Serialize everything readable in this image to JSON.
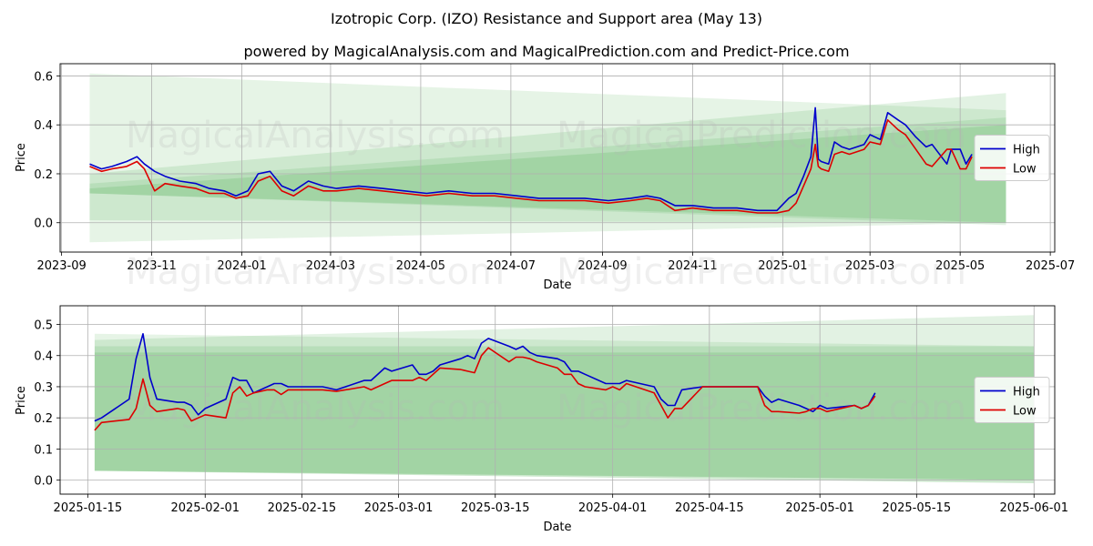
{
  "title": "Izotropic Corp. (IZO) Resistance and Support area (May 13)",
  "subtitle": "powered by MagicalAnalysis.com and MagicalPrediction.com and Predict-Price.com",
  "watermarks": [
    "MagicalAnalysis.com",
    "MagicalPrediction.com"
  ],
  "colors": {
    "high": "#0000cc",
    "low": "#dd0000",
    "band": "#4caf50"
  },
  "chart_data": [
    {
      "type": "line",
      "xlabel": "Date",
      "ylabel": "Price",
      "xlim": [
        "2023-08-31",
        "2025-07-04"
      ],
      "ylim": [
        -0.12,
        0.65
      ],
      "x_ticks": [
        "2023-09",
        "2023-11",
        "2024-01",
        "2024-03",
        "2024-05",
        "2024-07",
        "2024-09",
        "2024-11",
        "2025-01",
        "2025-03",
        "2025-05",
        "2025-07"
      ],
      "y_ticks": [
        0.0,
        0.2,
        0.4,
        0.6
      ],
      "y_tick_labels": [
        "0.0",
        "0.2",
        "0.4",
        "0.6"
      ],
      "grid": true,
      "legend_position": "right",
      "bands": [
        {
          "x": [
            "2023-09-20",
            "2025-06-01"
          ],
          "upper": [
            0.61,
            0.46
          ],
          "lower": [
            -0.08,
            0.0
          ]
        },
        {
          "x": [
            "2023-09-20",
            "2025-06-01"
          ],
          "upper": [
            0.2,
            0.53
          ],
          "lower": [
            0.01,
            0.0
          ]
        },
        {
          "x": [
            "2023-09-20",
            "2025-06-01"
          ],
          "upper": [
            0.16,
            0.43
          ],
          "lower": [
            0.12,
            -0.01
          ]
        },
        {
          "x": [
            "2023-09-20",
            "2025-06-01"
          ],
          "upper": [
            0.14,
            0.4
          ],
          "lower": [
            0.12,
            0.0
          ]
        }
      ],
      "series": [
        {
          "name": "High",
          "x": [
            "2023-09-20",
            "2023-09-28",
            "2023-10-05",
            "2023-10-15",
            "2023-10-22",
            "2023-10-27",
            "2023-11-03",
            "2023-11-10",
            "2023-11-20",
            "2023-12-01",
            "2023-12-10",
            "2023-12-20",
            "2023-12-28",
            "2024-01-05",
            "2024-01-12",
            "2024-01-20",
            "2024-01-28",
            "2024-02-05",
            "2024-02-15",
            "2024-02-25",
            "2024-03-05",
            "2024-03-20",
            "2024-04-05",
            "2024-04-20",
            "2024-05-05",
            "2024-05-20",
            "2024-06-05",
            "2024-06-20",
            "2024-07-05",
            "2024-07-20",
            "2024-08-05",
            "2024-08-20",
            "2024-09-05",
            "2024-09-20",
            "2024-10-01",
            "2024-10-10",
            "2024-10-20",
            "2024-11-01",
            "2024-11-15",
            "2024-12-01",
            "2024-12-15",
            "2024-12-28",
            "2025-01-05",
            "2025-01-10",
            "2025-01-15",
            "2025-01-20",
            "2025-01-23",
            "2025-01-25",
            "2025-01-27",
            "2025-02-01",
            "2025-02-05",
            "2025-02-10",
            "2025-02-15",
            "2025-02-25",
            "2025-03-01",
            "2025-03-08",
            "2025-03-13",
            "2025-03-20",
            "2025-03-25",
            "2025-04-01",
            "2025-04-08",
            "2025-04-12",
            "2025-04-22",
            "2025-04-25",
            "2025-05-01",
            "2025-05-05",
            "2025-05-09"
          ],
          "y": [
            0.24,
            0.22,
            0.23,
            0.25,
            0.27,
            0.24,
            0.21,
            0.19,
            0.17,
            0.16,
            0.14,
            0.13,
            0.11,
            0.13,
            0.2,
            0.21,
            0.15,
            0.13,
            0.17,
            0.15,
            0.14,
            0.15,
            0.14,
            0.13,
            0.12,
            0.13,
            0.12,
            0.12,
            0.11,
            0.1,
            0.1,
            0.1,
            0.09,
            0.1,
            0.11,
            0.1,
            0.07,
            0.07,
            0.06,
            0.06,
            0.05,
            0.05,
            0.1,
            0.12,
            0.19,
            0.27,
            0.47,
            0.26,
            0.25,
            0.24,
            0.33,
            0.31,
            0.3,
            0.32,
            0.36,
            0.34,
            0.45,
            0.42,
            0.4,
            0.35,
            0.31,
            0.32,
            0.24,
            0.3,
            0.3,
            0.24,
            0.28
          ]
        },
        {
          "name": "Low",
          "x": [
            "2023-09-20",
            "2023-09-28",
            "2023-10-05",
            "2023-10-15",
            "2023-10-22",
            "2023-10-27",
            "2023-11-03",
            "2023-11-10",
            "2023-11-20",
            "2023-12-01",
            "2023-12-10",
            "2023-12-20",
            "2023-12-28",
            "2024-01-05",
            "2024-01-12",
            "2024-01-20",
            "2024-01-28",
            "2024-02-05",
            "2024-02-15",
            "2024-02-25",
            "2024-03-05",
            "2024-03-20",
            "2024-04-05",
            "2024-04-20",
            "2024-05-05",
            "2024-05-20",
            "2024-06-05",
            "2024-06-20",
            "2024-07-05",
            "2024-07-20",
            "2024-08-05",
            "2024-08-20",
            "2024-09-05",
            "2024-09-20",
            "2024-10-01",
            "2024-10-10",
            "2024-10-20",
            "2024-11-01",
            "2024-11-15",
            "2024-12-01",
            "2024-12-15",
            "2024-12-28",
            "2025-01-05",
            "2025-01-10",
            "2025-01-15",
            "2025-01-20",
            "2025-01-23",
            "2025-01-25",
            "2025-01-27",
            "2025-02-01",
            "2025-02-05",
            "2025-02-10",
            "2025-02-15",
            "2025-02-25",
            "2025-03-01",
            "2025-03-08",
            "2025-03-13",
            "2025-03-20",
            "2025-03-25",
            "2025-04-01",
            "2025-04-08",
            "2025-04-12",
            "2025-04-22",
            "2025-04-25",
            "2025-05-01",
            "2025-05-05",
            "2025-05-09"
          ],
          "y": [
            0.23,
            0.21,
            0.22,
            0.23,
            0.25,
            0.22,
            0.13,
            0.16,
            0.15,
            0.14,
            0.12,
            0.12,
            0.1,
            0.11,
            0.17,
            0.19,
            0.13,
            0.11,
            0.15,
            0.13,
            0.13,
            0.14,
            0.13,
            0.12,
            0.11,
            0.12,
            0.11,
            0.11,
            0.1,
            0.09,
            0.09,
            0.09,
            0.08,
            0.09,
            0.1,
            0.09,
            0.05,
            0.06,
            0.05,
            0.05,
            0.04,
            0.04,
            0.05,
            0.08,
            0.15,
            0.22,
            0.32,
            0.23,
            0.22,
            0.21,
            0.28,
            0.29,
            0.28,
            0.3,
            0.33,
            0.32,
            0.42,
            0.38,
            0.36,
            0.3,
            0.24,
            0.23,
            0.3,
            0.3,
            0.22,
            0.22,
            0.27
          ]
        }
      ]
    },
    {
      "type": "line",
      "xlabel": "Date",
      "ylabel": "Price",
      "xlim": [
        "2025-01-11",
        "2025-06-04"
      ],
      "ylim": [
        -0.045,
        0.56
      ],
      "x_ticks": [
        "2025-01-15",
        "2025-02-01",
        "2025-02-15",
        "2025-03-01",
        "2025-03-15",
        "2025-04-01",
        "2025-04-15",
        "2025-05-01",
        "2025-05-15",
        "2025-06-01"
      ],
      "y_ticks": [
        0.0,
        0.1,
        0.2,
        0.3,
        0.4,
        0.5
      ],
      "y_tick_labels": [
        "0.0",
        "0.1",
        "0.2",
        "0.3",
        "0.4",
        "0.5"
      ],
      "grid": true,
      "legend_position": "right",
      "bands": [
        {
          "x": [
            "2025-01-16",
            "2025-06-01"
          ],
          "upper": [
            0.47,
            0.43
          ],
          "lower": [
            0.03,
            -0.01
          ]
        },
        {
          "x": [
            "2025-01-16",
            "2025-06-01"
          ],
          "upper": [
            0.45,
            0.53
          ],
          "lower": [
            0.03,
            0.0
          ]
        },
        {
          "x": [
            "2025-01-16",
            "2025-06-01"
          ],
          "upper": [
            0.43,
            0.43
          ],
          "lower": [
            0.03,
            -0.01
          ]
        },
        {
          "x": [
            "2025-01-16",
            "2025-06-01"
          ],
          "upper": [
            0.41,
            0.41
          ],
          "lower": [
            0.03,
            0.0
          ]
        }
      ],
      "series": [
        {
          "name": "High",
          "x": [
            "2025-01-16",
            "2025-01-17",
            "2025-01-21",
            "2025-01-22",
            "2025-01-23",
            "2025-01-24",
            "2025-01-25",
            "2025-01-28",
            "2025-01-29",
            "2025-01-30",
            "2025-01-31",
            "2025-02-01",
            "2025-02-04",
            "2025-02-05",
            "2025-02-06",
            "2025-02-07",
            "2025-02-08",
            "2025-02-10",
            "2025-02-11",
            "2025-02-12",
            "2025-02-13",
            "2025-02-14",
            "2025-02-15",
            "2025-02-18",
            "2025-02-20",
            "2025-02-24",
            "2025-02-25",
            "2025-02-27",
            "2025-02-28",
            "2025-03-03",
            "2025-03-04",
            "2025-03-05",
            "2025-03-06",
            "2025-03-07",
            "2025-03-10",
            "2025-03-11",
            "2025-03-12",
            "2025-03-13",
            "2025-03-14",
            "2025-03-17",
            "2025-03-18",
            "2025-03-19",
            "2025-03-20",
            "2025-03-21",
            "2025-03-24",
            "2025-03-25",
            "2025-03-26",
            "2025-03-27",
            "2025-03-28",
            "2025-03-31",
            "2025-04-01",
            "2025-04-02",
            "2025-04-03",
            "2025-04-07",
            "2025-04-08",
            "2025-04-09",
            "2025-04-10",
            "2025-04-11",
            "2025-04-14",
            "2025-04-15",
            "2025-04-22",
            "2025-04-23",
            "2025-04-24",
            "2025-04-25",
            "2025-04-28",
            "2025-04-29",
            "2025-04-30",
            "2025-05-01",
            "2025-05-02",
            "2025-05-06",
            "2025-05-07",
            "2025-05-08",
            "2025-05-09"
          ],
          "y": [
            0.19,
            0.2,
            0.26,
            0.39,
            0.47,
            0.33,
            0.26,
            0.25,
            0.25,
            0.24,
            0.21,
            0.23,
            0.26,
            0.33,
            0.32,
            0.32,
            0.28,
            0.3,
            0.31,
            0.31,
            0.3,
            0.3,
            0.3,
            0.3,
            0.29,
            0.32,
            0.32,
            0.36,
            0.35,
            0.37,
            0.34,
            0.34,
            0.35,
            0.37,
            0.39,
            0.4,
            0.39,
            0.44,
            0.455,
            0.43,
            0.42,
            0.43,
            0.41,
            0.4,
            0.39,
            0.38,
            0.35,
            0.35,
            0.34,
            0.31,
            0.31,
            0.31,
            0.32,
            0.3,
            0.26,
            0.24,
            0.24,
            0.29,
            0.3,
            0.3,
            0.3,
            0.27,
            0.25,
            0.26,
            0.24,
            0.23,
            0.22,
            0.24,
            0.23,
            0.24,
            0.23,
            0.24,
            0.28
          ]
        },
        {
          "name": "Low",
          "x": [
            "2025-01-16",
            "2025-01-17",
            "2025-01-21",
            "2025-01-22",
            "2025-01-23",
            "2025-01-24",
            "2025-01-25",
            "2025-01-28",
            "2025-01-29",
            "2025-01-30",
            "2025-01-31",
            "2025-02-01",
            "2025-02-04",
            "2025-02-05",
            "2025-02-06",
            "2025-02-07",
            "2025-02-08",
            "2025-02-10",
            "2025-02-11",
            "2025-02-12",
            "2025-02-13",
            "2025-02-14",
            "2025-02-15",
            "2025-02-18",
            "2025-02-20",
            "2025-02-24",
            "2025-02-25",
            "2025-02-27",
            "2025-02-28",
            "2025-03-03",
            "2025-03-04",
            "2025-03-05",
            "2025-03-06",
            "2025-03-07",
            "2025-03-10",
            "2025-03-11",
            "2025-03-12",
            "2025-03-13",
            "2025-03-14",
            "2025-03-17",
            "2025-03-18",
            "2025-03-19",
            "2025-03-20",
            "2025-03-21",
            "2025-03-24",
            "2025-03-25",
            "2025-03-26",
            "2025-03-27",
            "2025-03-28",
            "2025-03-31",
            "2025-04-01",
            "2025-04-02",
            "2025-04-03",
            "2025-04-07",
            "2025-04-08",
            "2025-04-09",
            "2025-04-10",
            "2025-04-11",
            "2025-04-14",
            "2025-04-15",
            "2025-04-22",
            "2025-04-23",
            "2025-04-24",
            "2025-04-25",
            "2025-04-28",
            "2025-04-29",
            "2025-04-30",
            "2025-05-01",
            "2025-05-02",
            "2025-05-06",
            "2025-05-07",
            "2025-05-08",
            "2025-05-09"
          ],
          "y": [
            0.16,
            0.185,
            0.195,
            0.23,
            0.325,
            0.24,
            0.22,
            0.23,
            0.225,
            0.19,
            0.2,
            0.21,
            0.2,
            0.28,
            0.3,
            0.27,
            0.28,
            0.29,
            0.29,
            0.275,
            0.29,
            0.29,
            0.29,
            0.29,
            0.285,
            0.3,
            0.29,
            0.31,
            0.32,
            0.32,
            0.33,
            0.32,
            0.34,
            0.36,
            0.355,
            0.35,
            0.345,
            0.4,
            0.425,
            0.38,
            0.395,
            0.395,
            0.39,
            0.38,
            0.36,
            0.34,
            0.34,
            0.31,
            0.3,
            0.29,
            0.3,
            0.29,
            0.31,
            0.28,
            0.24,
            0.2,
            0.23,
            0.23,
            0.3,
            0.3,
            0.3,
            0.24,
            0.22,
            0.22,
            0.215,
            0.22,
            0.23,
            0.23,
            0.22,
            0.24,
            0.23,
            0.24,
            0.27
          ]
        }
      ]
    }
  ]
}
